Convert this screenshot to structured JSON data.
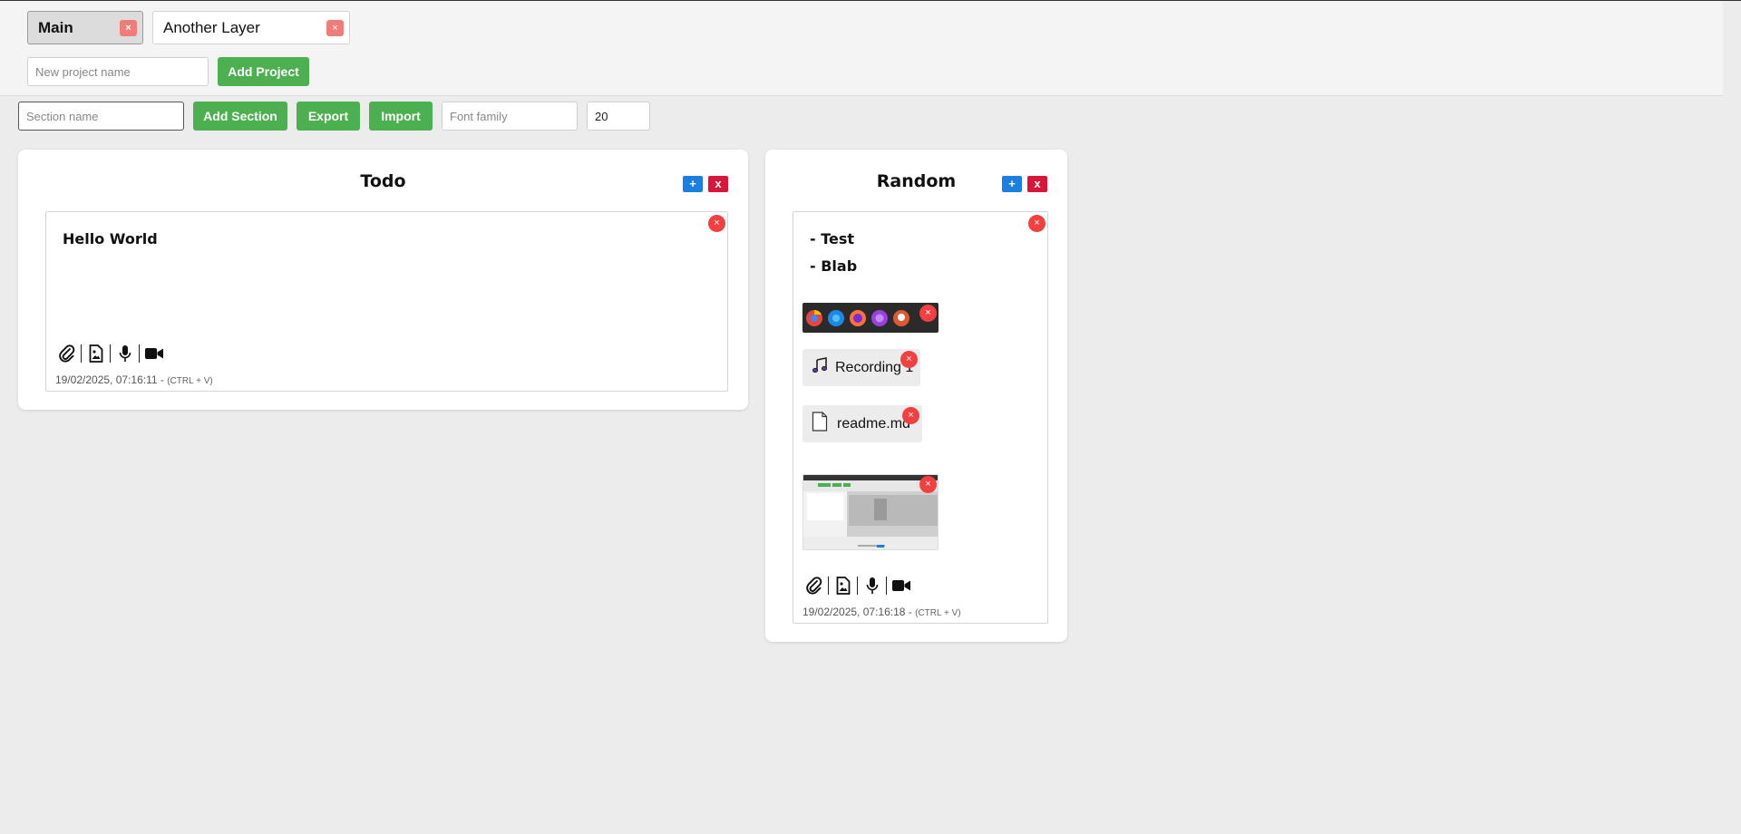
{
  "projects": {
    "tabs": [
      {
        "label": "Main",
        "close": "×",
        "active": true
      },
      {
        "label": "Another Layer",
        "close": "×",
        "active": false
      }
    ],
    "new_project_placeholder": "New project name",
    "add_project_label": "Add Project"
  },
  "toolbar": {
    "section_placeholder": "Section name",
    "add_section_label": "Add Section",
    "export_label": "Export",
    "import_label": "Import",
    "font_family_placeholder": "Font family",
    "font_size_value": "20"
  },
  "sections": [
    {
      "title": "Todo",
      "add_label": "+",
      "delete_label": "x",
      "note": {
        "heading": "Hello World",
        "close": "×",
        "timestamp": "19/02/2025, 07:16:11 - ",
        "shortcut": "(CTRL + V)"
      }
    },
    {
      "title": "Random",
      "add_label": "+",
      "delete_label": "x",
      "note": {
        "lines": [
          "- Test",
          "- Blab"
        ],
        "close": "×",
        "audio_label": "Recording 1",
        "file_label": "readme.md",
        "attachment_close": "×",
        "timestamp": "19/02/2025, 07:16:18 - ",
        "shortcut": "(CTRL + V)"
      }
    }
  ],
  "colors": {
    "green": "#4caf50",
    "blue": "#1a7fe0",
    "red": "#d9163a",
    "close_red": "#f04040"
  },
  "icons": [
    "paperclip-icon",
    "image-file-icon",
    "microphone-icon",
    "video-camera-icon",
    "music-note-icon",
    "document-icon"
  ]
}
